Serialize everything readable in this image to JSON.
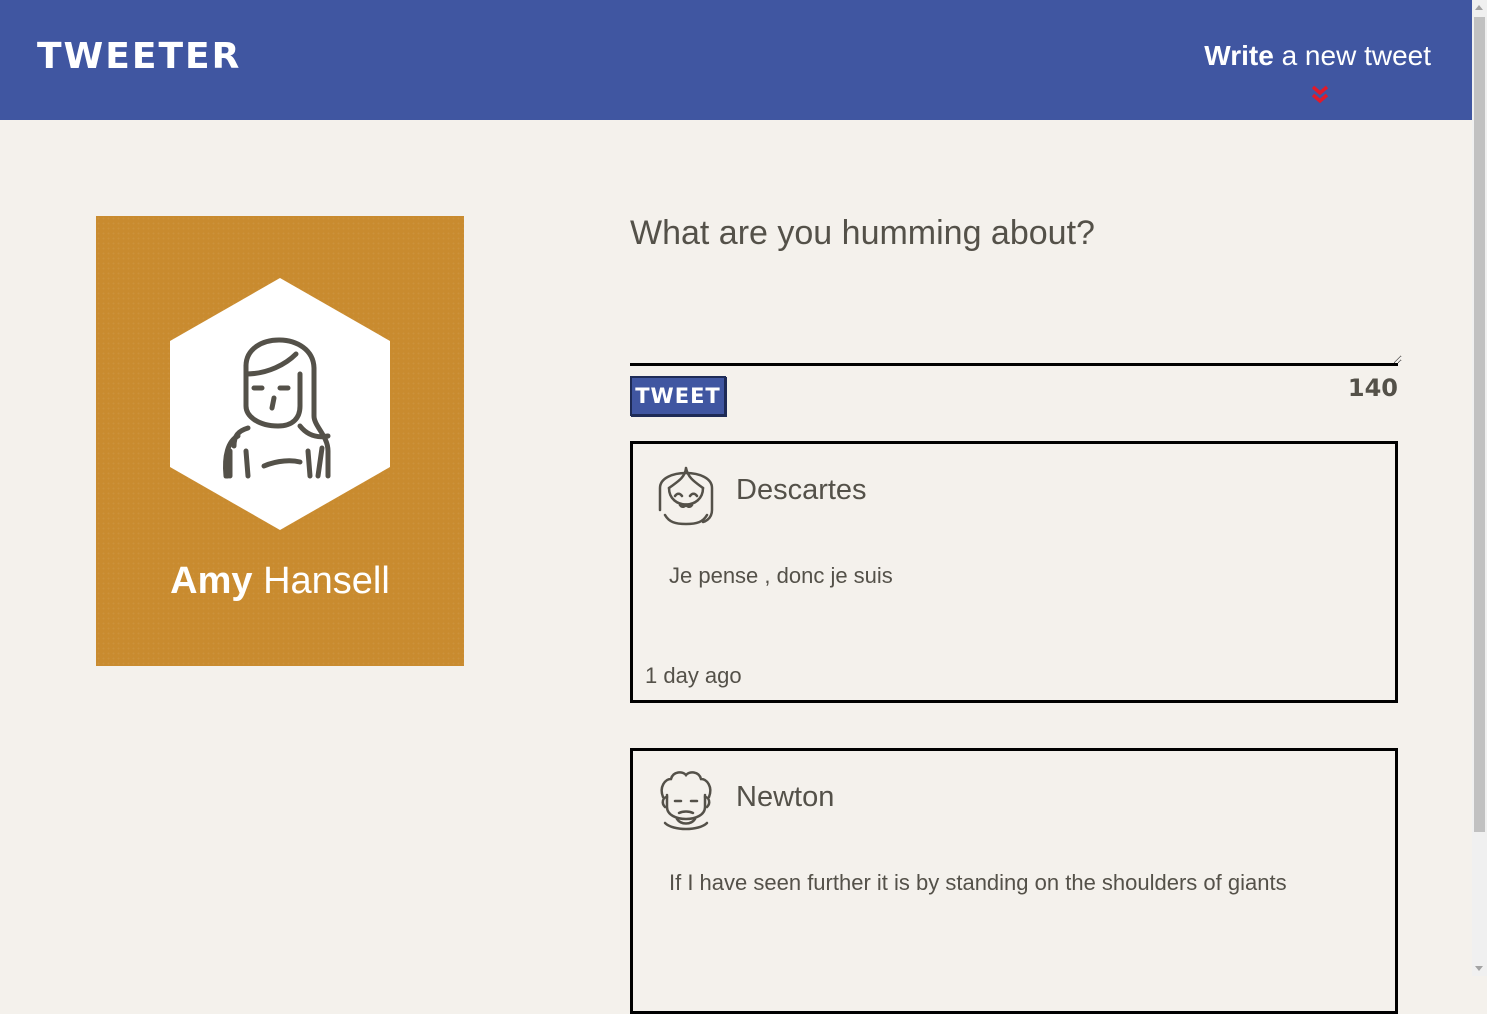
{
  "nav": {
    "logo": "TWEETER",
    "compose_bold": "Write",
    "compose_rest": " a new tweet"
  },
  "profile": {
    "first_name": "Amy",
    "last_name": " Hansell",
    "avatar_icon": "woman-avatar-icon",
    "background_color": "#c98b2f"
  },
  "composer": {
    "prompt": "What are you humming about?",
    "button_label": "TWEET",
    "counter": "140"
  },
  "tweets": [
    {
      "author": "Descartes",
      "avatar_icon": "girl-face-avatar-icon",
      "content": "Je pense , donc je suis",
      "time": "1 day ago"
    },
    {
      "author": "Newton",
      "avatar_icon": "curly-hair-face-avatar-icon",
      "content": "If I have seen further it is by standing on the shoulders of giants",
      "time": ""
    }
  ],
  "colors": {
    "navbar": "#4056a1",
    "page_background": "#f4f1ec",
    "accent_arrow": "#e01a2a"
  }
}
